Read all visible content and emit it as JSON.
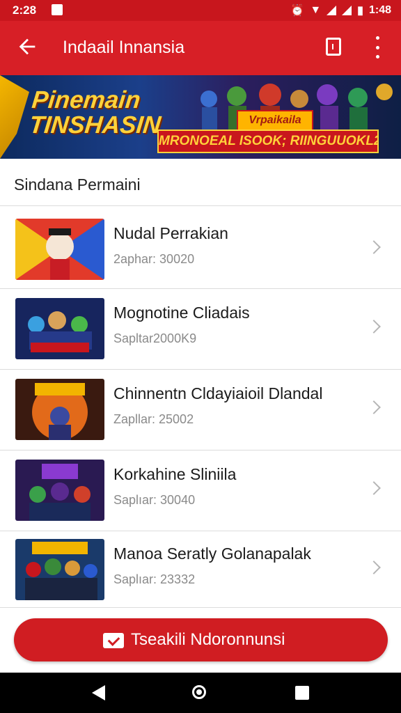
{
  "status_bar": {
    "time": "2:28",
    "clock_right": "1:48",
    "icons": [
      "notification-icon",
      "alarm-icon",
      "wifi-icon",
      "signal-icon",
      "battery-icon"
    ]
  },
  "app_bar": {
    "title": "Indaail Innansia",
    "icons": [
      "back-arrow-icon",
      "bookmark-icon",
      "more-vert-icon"
    ]
  },
  "banner": {
    "headline_line1": "Pinemain",
    "headline_line2": "TINSHASIN",
    "sign": "Vrpaikaila",
    "tagline": "MRONOEAL ISOOK; RIINGUUOKL2"
  },
  "section": {
    "title": "Sindana Permaini"
  },
  "items": [
    {
      "name": "Nudal Perrakian",
      "sub": "2aphar: 30020",
      "thumb": "clown-hero"
    },
    {
      "name": "Mognotine Cliadais",
      "sub": "Sapltar2000K9",
      "thumb": "team-blue"
    },
    {
      "name": "Chinnentn Cldayiaioil Dlandal",
      "sub": "Zapllar: 25002",
      "thumb": "hero-orange"
    },
    {
      "name": "Korkahine Sliniila",
      "sub": "Saplıar: 30040",
      "thumb": "team-purple"
    },
    {
      "name": "Manoa Seratly Golanapalak",
      "sub": "Saplıar: 23332",
      "thumb": "team-green"
    }
  ],
  "cta": {
    "label": "Tseakili Ndoronnunsi"
  },
  "colors": {
    "primary": "#d71f26",
    "status": "#c8161d",
    "accent_gold": "#ffd23a"
  }
}
